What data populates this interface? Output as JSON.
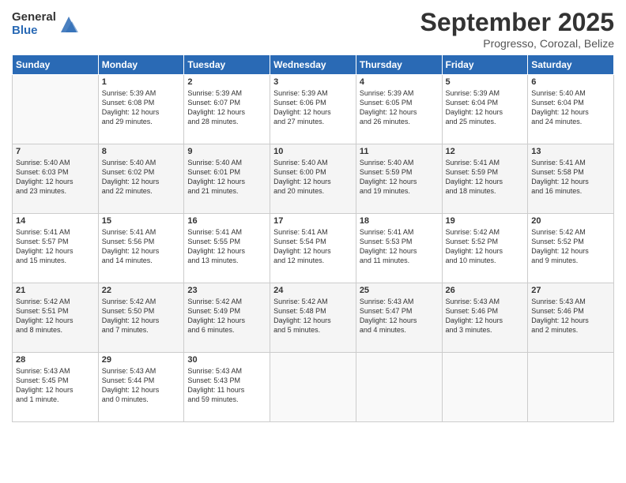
{
  "logo": {
    "general": "General",
    "blue": "Blue"
  },
  "header": {
    "month": "September 2025",
    "location": "Progresso, Corozal, Belize"
  },
  "weekdays": [
    "Sunday",
    "Monday",
    "Tuesday",
    "Wednesday",
    "Thursday",
    "Friday",
    "Saturday"
  ],
  "weeks": [
    [
      {
        "day": "",
        "info": ""
      },
      {
        "day": "1",
        "info": "Sunrise: 5:39 AM\nSunset: 6:08 PM\nDaylight: 12 hours\nand 29 minutes."
      },
      {
        "day": "2",
        "info": "Sunrise: 5:39 AM\nSunset: 6:07 PM\nDaylight: 12 hours\nand 28 minutes."
      },
      {
        "day": "3",
        "info": "Sunrise: 5:39 AM\nSunset: 6:06 PM\nDaylight: 12 hours\nand 27 minutes."
      },
      {
        "day": "4",
        "info": "Sunrise: 5:39 AM\nSunset: 6:05 PM\nDaylight: 12 hours\nand 26 minutes."
      },
      {
        "day": "5",
        "info": "Sunrise: 5:39 AM\nSunset: 6:04 PM\nDaylight: 12 hours\nand 25 minutes."
      },
      {
        "day": "6",
        "info": "Sunrise: 5:40 AM\nSunset: 6:04 PM\nDaylight: 12 hours\nand 24 minutes."
      }
    ],
    [
      {
        "day": "7",
        "info": "Sunrise: 5:40 AM\nSunset: 6:03 PM\nDaylight: 12 hours\nand 23 minutes."
      },
      {
        "day": "8",
        "info": "Sunrise: 5:40 AM\nSunset: 6:02 PM\nDaylight: 12 hours\nand 22 minutes."
      },
      {
        "day": "9",
        "info": "Sunrise: 5:40 AM\nSunset: 6:01 PM\nDaylight: 12 hours\nand 21 minutes."
      },
      {
        "day": "10",
        "info": "Sunrise: 5:40 AM\nSunset: 6:00 PM\nDaylight: 12 hours\nand 20 minutes."
      },
      {
        "day": "11",
        "info": "Sunrise: 5:40 AM\nSunset: 5:59 PM\nDaylight: 12 hours\nand 19 minutes."
      },
      {
        "day": "12",
        "info": "Sunrise: 5:41 AM\nSunset: 5:59 PM\nDaylight: 12 hours\nand 18 minutes."
      },
      {
        "day": "13",
        "info": "Sunrise: 5:41 AM\nSunset: 5:58 PM\nDaylight: 12 hours\nand 16 minutes."
      }
    ],
    [
      {
        "day": "14",
        "info": "Sunrise: 5:41 AM\nSunset: 5:57 PM\nDaylight: 12 hours\nand 15 minutes."
      },
      {
        "day": "15",
        "info": "Sunrise: 5:41 AM\nSunset: 5:56 PM\nDaylight: 12 hours\nand 14 minutes."
      },
      {
        "day": "16",
        "info": "Sunrise: 5:41 AM\nSunset: 5:55 PM\nDaylight: 12 hours\nand 13 minutes."
      },
      {
        "day": "17",
        "info": "Sunrise: 5:41 AM\nSunset: 5:54 PM\nDaylight: 12 hours\nand 12 minutes."
      },
      {
        "day": "18",
        "info": "Sunrise: 5:41 AM\nSunset: 5:53 PM\nDaylight: 12 hours\nand 11 minutes."
      },
      {
        "day": "19",
        "info": "Sunrise: 5:42 AM\nSunset: 5:52 PM\nDaylight: 12 hours\nand 10 minutes."
      },
      {
        "day": "20",
        "info": "Sunrise: 5:42 AM\nSunset: 5:52 PM\nDaylight: 12 hours\nand 9 minutes."
      }
    ],
    [
      {
        "day": "21",
        "info": "Sunrise: 5:42 AM\nSunset: 5:51 PM\nDaylight: 12 hours\nand 8 minutes."
      },
      {
        "day": "22",
        "info": "Sunrise: 5:42 AM\nSunset: 5:50 PM\nDaylight: 12 hours\nand 7 minutes."
      },
      {
        "day": "23",
        "info": "Sunrise: 5:42 AM\nSunset: 5:49 PM\nDaylight: 12 hours\nand 6 minutes."
      },
      {
        "day": "24",
        "info": "Sunrise: 5:42 AM\nSunset: 5:48 PM\nDaylight: 12 hours\nand 5 minutes."
      },
      {
        "day": "25",
        "info": "Sunrise: 5:43 AM\nSunset: 5:47 PM\nDaylight: 12 hours\nand 4 minutes."
      },
      {
        "day": "26",
        "info": "Sunrise: 5:43 AM\nSunset: 5:46 PM\nDaylight: 12 hours\nand 3 minutes."
      },
      {
        "day": "27",
        "info": "Sunrise: 5:43 AM\nSunset: 5:46 PM\nDaylight: 12 hours\nand 2 minutes."
      }
    ],
    [
      {
        "day": "28",
        "info": "Sunrise: 5:43 AM\nSunset: 5:45 PM\nDaylight: 12 hours\nand 1 minute."
      },
      {
        "day": "29",
        "info": "Sunrise: 5:43 AM\nSunset: 5:44 PM\nDaylight: 12 hours\nand 0 minutes."
      },
      {
        "day": "30",
        "info": "Sunrise: 5:43 AM\nSunset: 5:43 PM\nDaylight: 11 hours\nand 59 minutes."
      },
      {
        "day": "",
        "info": ""
      },
      {
        "day": "",
        "info": ""
      },
      {
        "day": "",
        "info": ""
      },
      {
        "day": "",
        "info": ""
      }
    ]
  ]
}
